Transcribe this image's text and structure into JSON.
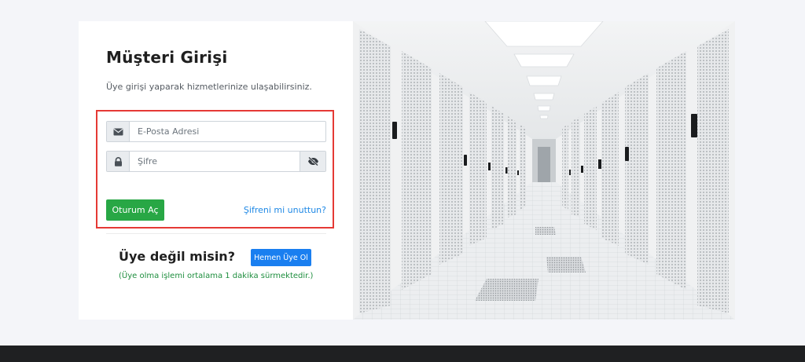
{
  "login": {
    "title": "Müşteri Girişi",
    "subtitle": "Üye girişi yaparak hizmetlerinize ulaşabilirsiniz.",
    "email": {
      "placeholder": "E-Posta Adresi",
      "value": "",
      "icon": "envelope-icon"
    },
    "password": {
      "placeholder": "Şifre",
      "value": "",
      "icon": "lock-icon",
      "toggle_icon": "eye-slash-icon"
    },
    "submit_label": "Oturum Aç",
    "forgot_label": "Şifreni mi unuttun?",
    "highlight_color": "#e53935"
  },
  "register": {
    "heading": "Üye değil misin?",
    "button_label": "Hemen Üye Ol",
    "note": "(Üye olma işlemi ortalama 1 dakika sürmektedir.)"
  },
  "colors": {
    "primary_button": "#28a745",
    "secondary_button": "#1a7ff0",
    "link": "#1e88e5",
    "note_text": "#1e8e3e",
    "footer": "#1f2022"
  },
  "hero_image": {
    "subject": "datacenter-corridor-illustration"
  }
}
